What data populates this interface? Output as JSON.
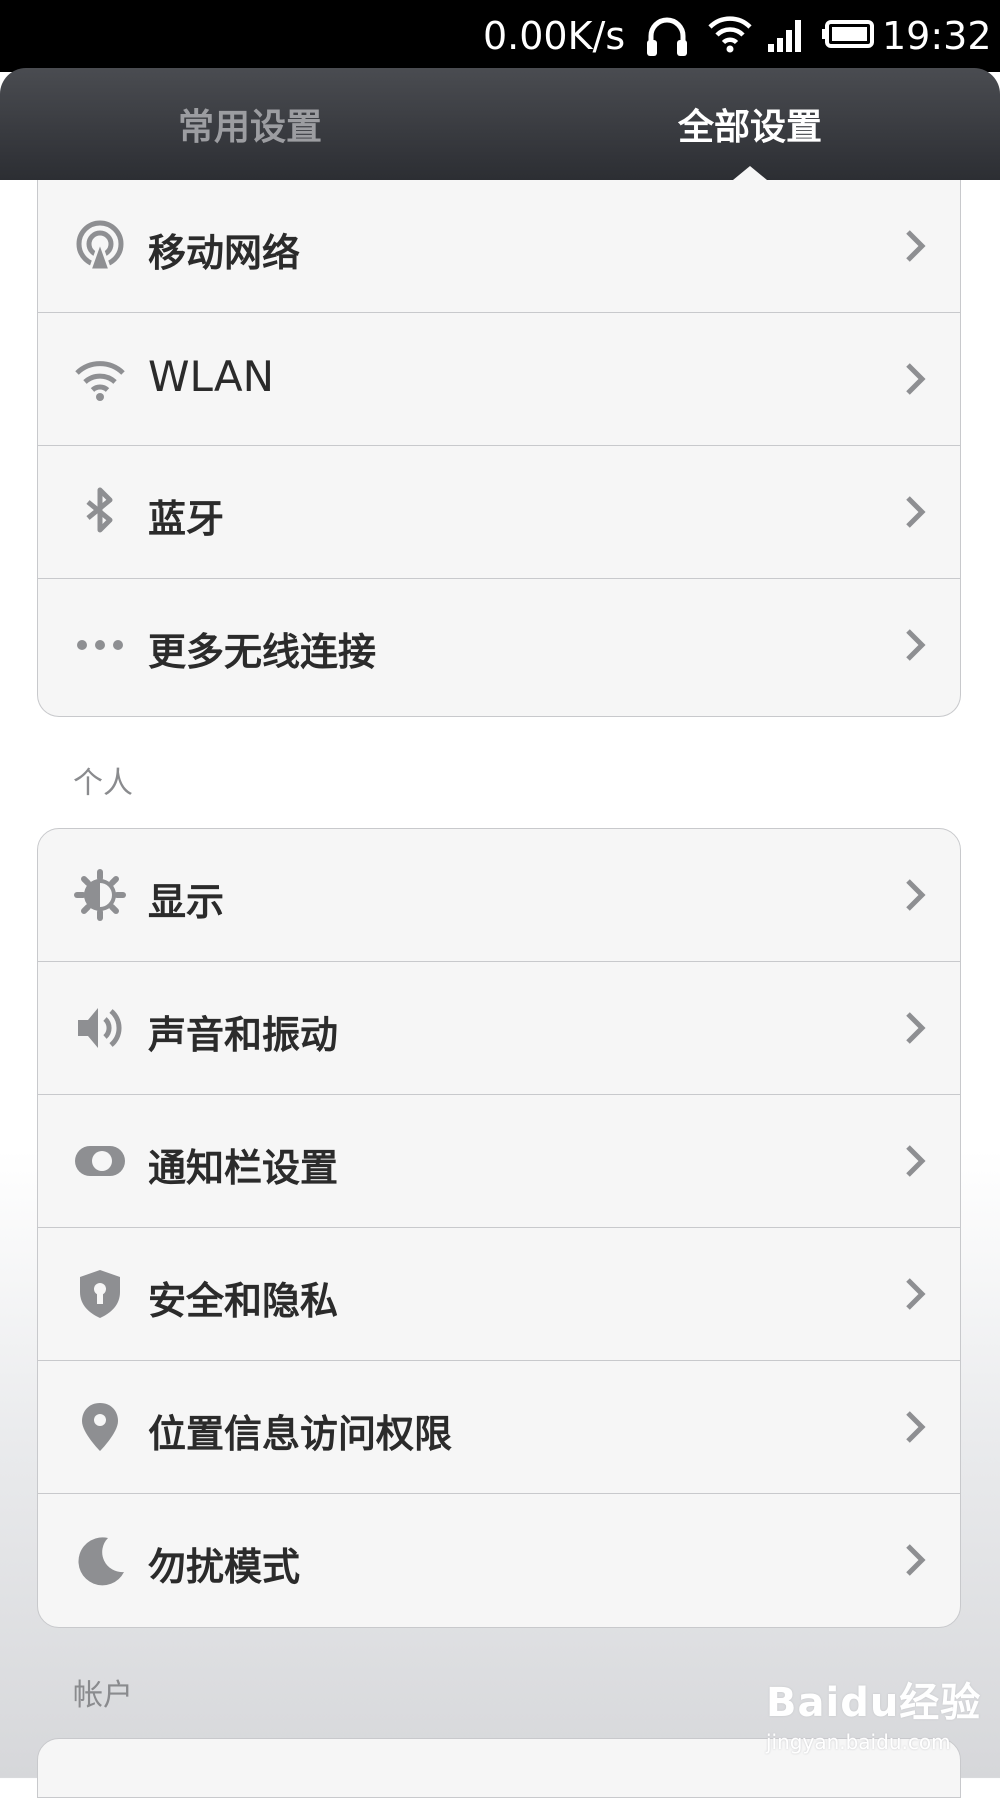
{
  "status_bar": {
    "net_speed": "0.00K/s",
    "time": "19:32",
    "icons": [
      "headphones-icon",
      "wifi-icon",
      "signal-icon",
      "battery-icon"
    ]
  },
  "tabs": [
    {
      "label": "常用设置",
      "selected": false
    },
    {
      "label": "全部设置",
      "selected": true
    }
  ],
  "groups": {
    "wireless": {
      "items": [
        {
          "label": "移动网络",
          "icon": "mobile-network-icon"
        },
        {
          "label": "WLAN",
          "icon": "wifi-icon"
        },
        {
          "label": "蓝牙",
          "icon": "bluetooth-icon"
        },
        {
          "label": "更多无线连接",
          "icon": "more-dots-icon"
        }
      ]
    },
    "personal": {
      "title": "个人",
      "items": [
        {
          "label": "显示",
          "icon": "brightness-icon"
        },
        {
          "label": "声音和振动",
          "icon": "speaker-icon"
        },
        {
          "label": "通知栏设置",
          "icon": "toggle-icon"
        },
        {
          "label": "安全和隐私",
          "icon": "shield-icon"
        },
        {
          "label": "位置信息访问权限",
          "icon": "location-pin-icon"
        },
        {
          "label": "勿扰模式",
          "icon": "moon-icon"
        }
      ]
    },
    "account": {
      "title": "帐户"
    }
  },
  "watermark": {
    "main": "Baidu经验",
    "sub": "jingyan.baidu.com"
  },
  "colors": {
    "tab_bar": "#3a3c41",
    "row_bg": "#f6f6f6",
    "icon_gray": "#8e8f92",
    "divider": "#c8c9cc"
  }
}
